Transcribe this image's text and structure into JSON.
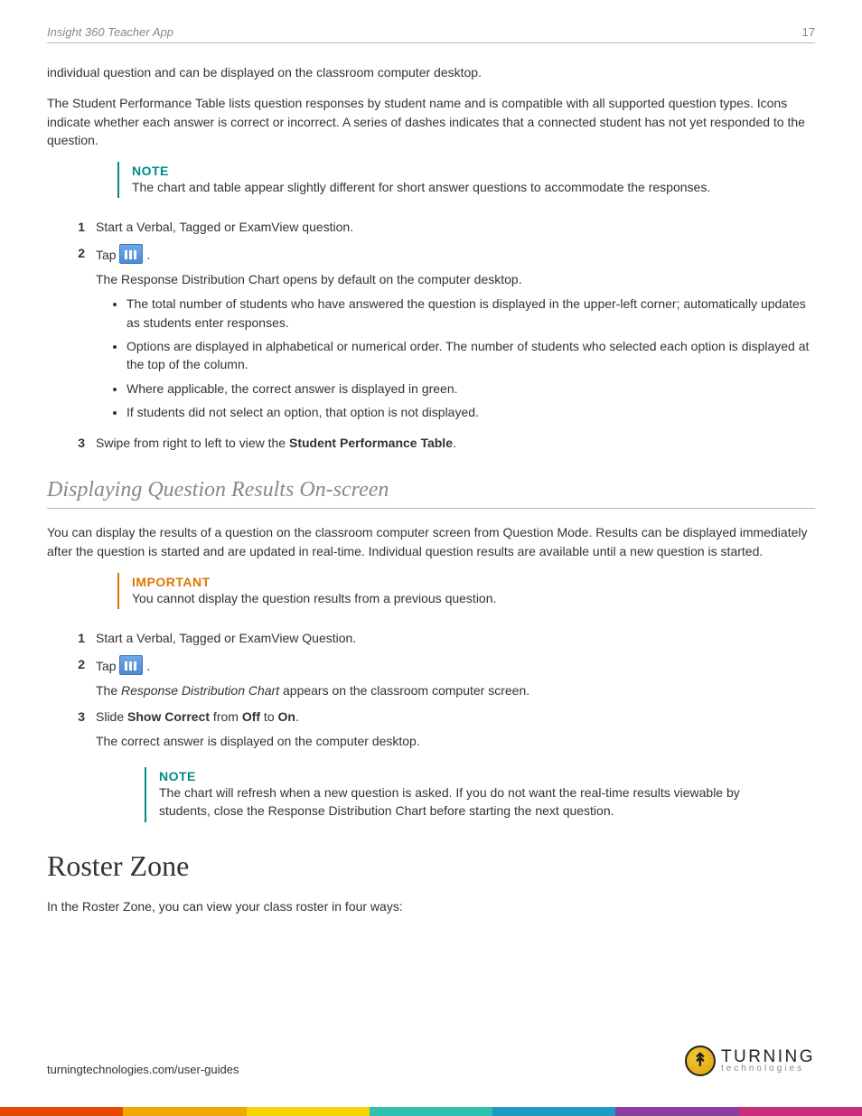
{
  "header": {
    "title": "Insight 360 Teacher App",
    "page": "17"
  },
  "intro": {
    "p1": "individual question and can be displayed on the classroom computer desktop.",
    "p2": "The Student Performance Table lists question responses by student name and is compatible with all supported question types. Icons indicate whether each answer is correct or incorrect. A series of dashes indicates that a connected student has not yet responded to the question."
  },
  "note1": {
    "title": "NOTE",
    "body": "The chart and table appear slightly different for short answer questions to accommodate the responses."
  },
  "steps1": {
    "s1": "Start a Verbal, Tagged or ExamView question.",
    "s2_pre": "Tap ",
    "s2_post": " .",
    "s2_sub_intro": "The Response Distribution Chart opens by default on the computer desktop.",
    "bullets": [
      "The total number of students who have answered the question is displayed in the upper-left corner; automatically updates as students enter responses.",
      "Options are displayed in alphabetical or numerical order. The number of students who selected each option is displayed at the top of the column.",
      "Where applicable, the correct answer is displayed in green.",
      "If students did not select an option, that option is not displayed."
    ],
    "s3_pre": "Swipe from right to left to view the ",
    "s3_bold": "Student Performance Table",
    "s3_post": "."
  },
  "section2": {
    "heading": "Displaying Question Results On-screen",
    "intro": "You can display the results of a question on the classroom computer screen from Question Mode. Results can be displayed immediately after the question is started and are updated in real-time. Individual question results are available until a new question is started."
  },
  "important1": {
    "title": "IMPORTANT",
    "body": "You cannot display the question results from a previous question."
  },
  "steps2": {
    "s1": "Start a Verbal, Tagged or ExamView Question.",
    "s2_pre": "Tap ",
    "s2_post": " .",
    "s2_sub": "The ",
    "s2_sub_em": "Response Distribution Chart",
    "s2_sub_post": " appears on the classroom computer screen.",
    "s3_pre": "Slide ",
    "s3_b1": "Show Correct",
    "s3_mid1": " from ",
    "s3_b2": "Off",
    "s3_mid2": " to ",
    "s3_b3": "On",
    "s3_post": ".",
    "s3_sub": "The correct answer is displayed on the computer desktop."
  },
  "note2": {
    "title": "NOTE",
    "body": "The chart will refresh when a new question is asked. If you do not want the real-time results viewable by students, close the Response Distribution Chart before starting the next question."
  },
  "section3": {
    "heading": "Roster Zone",
    "intro": "In the Roster Zone, you can view your class roster in four ways:"
  },
  "footer": {
    "url": "turningtechnologies.com/user-guides",
    "brand_top": "TURNING",
    "brand_bot": "technologies"
  },
  "colors": [
    "#e54b00",
    "#f0a800",
    "#f6d400",
    "#2fc1b0",
    "#1f99c8",
    "#8a3fa0",
    "#c92d7a"
  ]
}
